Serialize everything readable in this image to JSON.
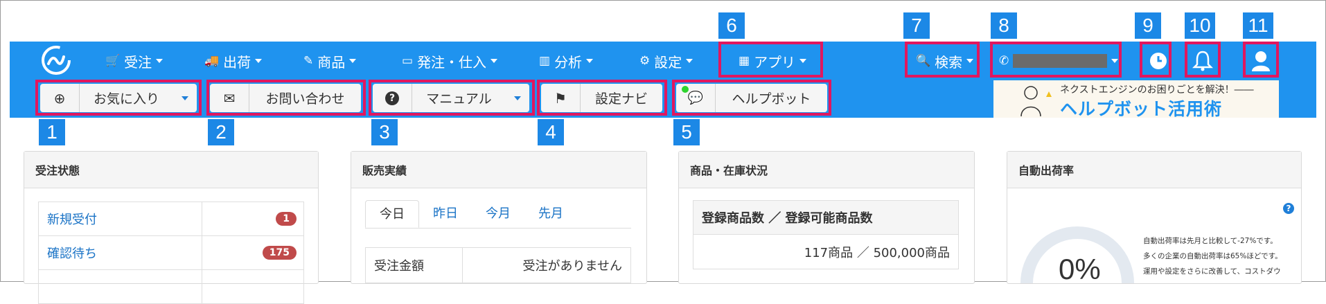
{
  "nav": {
    "menus": [
      {
        "label": "受注",
        "icon": "cart-icon",
        "glyph": "🛒"
      },
      {
        "label": "出荷",
        "icon": "truck-icon",
        "glyph": "🚚"
      },
      {
        "label": "商品",
        "icon": "pencil-icon",
        "glyph": "✎"
      },
      {
        "label": "発注・仕入",
        "icon": "inbox-icon",
        "glyph": "▭"
      },
      {
        "label": "分析",
        "icon": "bar-chart-icon",
        "glyph": "▥"
      },
      {
        "label": "設定",
        "icon": "gear-icon",
        "glyph": "⚙"
      },
      {
        "label": "アプリ",
        "icon": "apps-grid-icon",
        "glyph": "▦"
      },
      {
        "label": "検索",
        "icon": "search-icon",
        "glyph": "🔍"
      }
    ],
    "phone_icon": "phone-icon",
    "right_icons": [
      "history-clock-icon",
      "bell-icon",
      "user-icon"
    ]
  },
  "subnav": {
    "buttons": [
      {
        "label": "お気に入り",
        "icon": "plus-circle-icon",
        "glyph": "⊕"
      },
      {
        "label": "お問い合わせ",
        "icon": "envelope-icon",
        "glyph": "✉"
      },
      {
        "label": "マニュアル",
        "icon": "question-circle-icon",
        "glyph": "?"
      },
      {
        "label": "設定ナビ",
        "icon": "flag-icon",
        "glyph": "⚑"
      },
      {
        "label": "ヘルプボット",
        "icon": "chat-bubbles-icon",
        "glyph": "💬"
      }
    ],
    "banner": {
      "line1": "ネクストエンジンのお困りごとを解決！――",
      "line2": "ヘルプボット活用術"
    }
  },
  "annotations": [
    "1",
    "2",
    "3",
    "4",
    "5",
    "6",
    "7",
    "8",
    "9",
    "10",
    "11"
  ],
  "panels": {
    "order_status": {
      "title": "受注状態",
      "rows": [
        {
          "label": "新規受付",
          "count": "1"
        },
        {
          "label": "確認待ち",
          "count": "175"
        }
      ]
    },
    "sales": {
      "title": "販売実績",
      "tabs": [
        "今日",
        "昨日",
        "今月",
        "先月"
      ],
      "row_label": "受注金額",
      "row_value": "受注がありません"
    },
    "inventory": {
      "title": "商品・在庫状況",
      "header": "登録商品数 ／ 登録可能商品数",
      "value": "117商品 ／ 500,000商品"
    },
    "auto_ship": {
      "title": "自動出荷率",
      "gauge_value": "0%",
      "lines": [
        "自動出荷率は先月と比較して-27%です。",
        "多くの企業の自動出荷率は65%ほどです。",
        "運用や設定をさらに改善して、コストダウ"
      ]
    }
  },
  "colors": {
    "nav_bg": "#1f93ef",
    "highlight": "#e0175f",
    "badge_bg": "#1c88e6",
    "count_badge": "#c04a4a",
    "link": "#1a73c6"
  }
}
